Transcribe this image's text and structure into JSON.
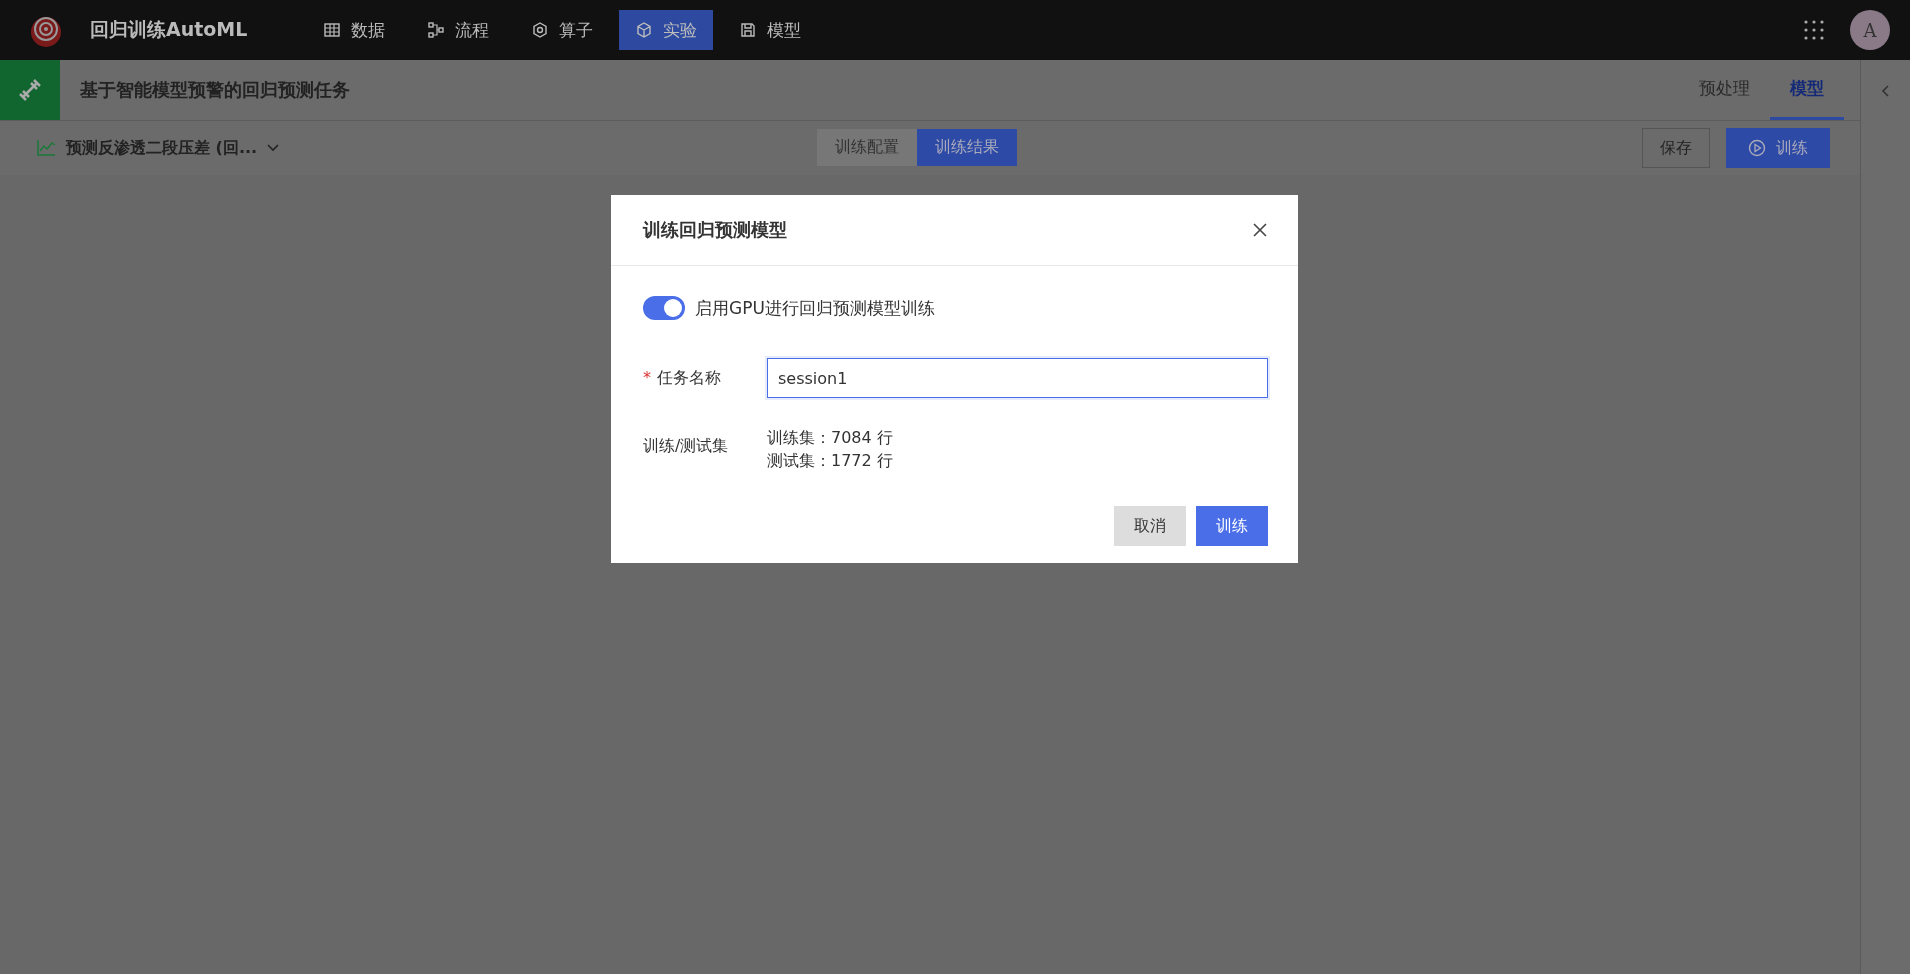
{
  "app": {
    "title": "回归训练AutoML"
  },
  "nav": [
    {
      "label": "数据",
      "kind": "table",
      "selected": false
    },
    {
      "label": "流程",
      "kind": "flow",
      "selected": false
    },
    {
      "label": "算子",
      "kind": "hex",
      "selected": false
    },
    {
      "label": "实验",
      "kind": "cube",
      "selected": true
    },
    {
      "label": "模型",
      "kind": "disk",
      "selected": false
    }
  ],
  "avatar": {
    "initial": "A"
  },
  "header": {
    "title": "基于智能模型预警的回归预测任务",
    "tabs": [
      {
        "label": "预处理",
        "selected": false
      },
      {
        "label": "模型",
        "selected": true
      }
    ]
  },
  "toolbar": {
    "target": "预测反渗透二段压差 (回...",
    "segments": [
      {
        "label": "训练配置",
        "selected": false
      },
      {
        "label": "训练结果",
        "selected": true
      }
    ],
    "save": "保存",
    "train": "训练"
  },
  "dialog": {
    "title": "训练回归预测模型",
    "gpu": {
      "label": "启用GPU进行回归预测模型训练",
      "on": true
    },
    "name_field": {
      "label": "任务名称",
      "required_mark": "*",
      "value": "session1"
    },
    "split": {
      "label": "训练/测试集",
      "lines": [
        "训练集：7084 行",
        "测试集：1772 行"
      ]
    },
    "buttons": [
      {
        "label": "取消",
        "kind": "secondary"
      },
      {
        "label": "训练",
        "kind": "primary"
      }
    ]
  }
}
